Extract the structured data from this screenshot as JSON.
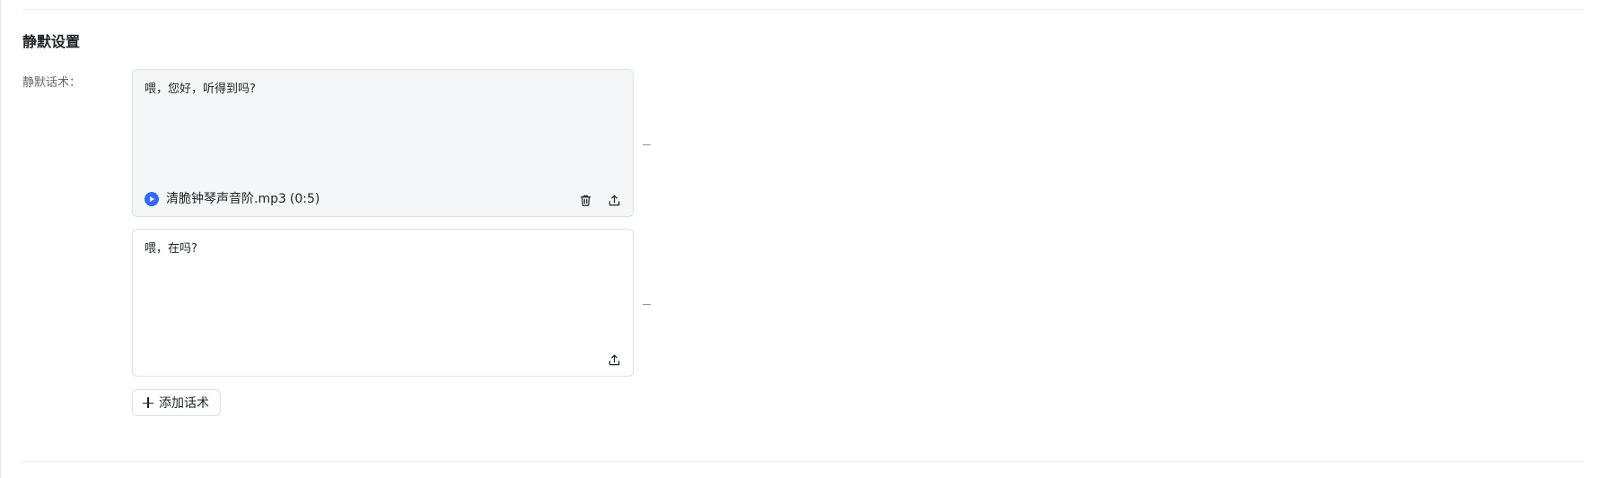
{
  "section": {
    "title": "静默设置",
    "field_label": "静默话术："
  },
  "scripts": [
    {
      "text": "喂，您好，听得到吗?",
      "audio": {
        "file_name": "清脆钟琴声音阶.mp3",
        "duration": "(0:5)"
      }
    },
    {
      "text": "喂，在吗?"
    }
  ],
  "add_button": {
    "label": "添加话术"
  },
  "colors": {
    "accent": "#2f6bf6",
    "card_filled_bg": "#f5f6f7",
    "border": "#dee0e3",
    "label_text": "#646a73"
  },
  "icons": {
    "play": "play-circle-icon",
    "delete": "trash-icon",
    "upload": "upload-icon",
    "remove": "minus-icon",
    "add": "plus-icon"
  }
}
